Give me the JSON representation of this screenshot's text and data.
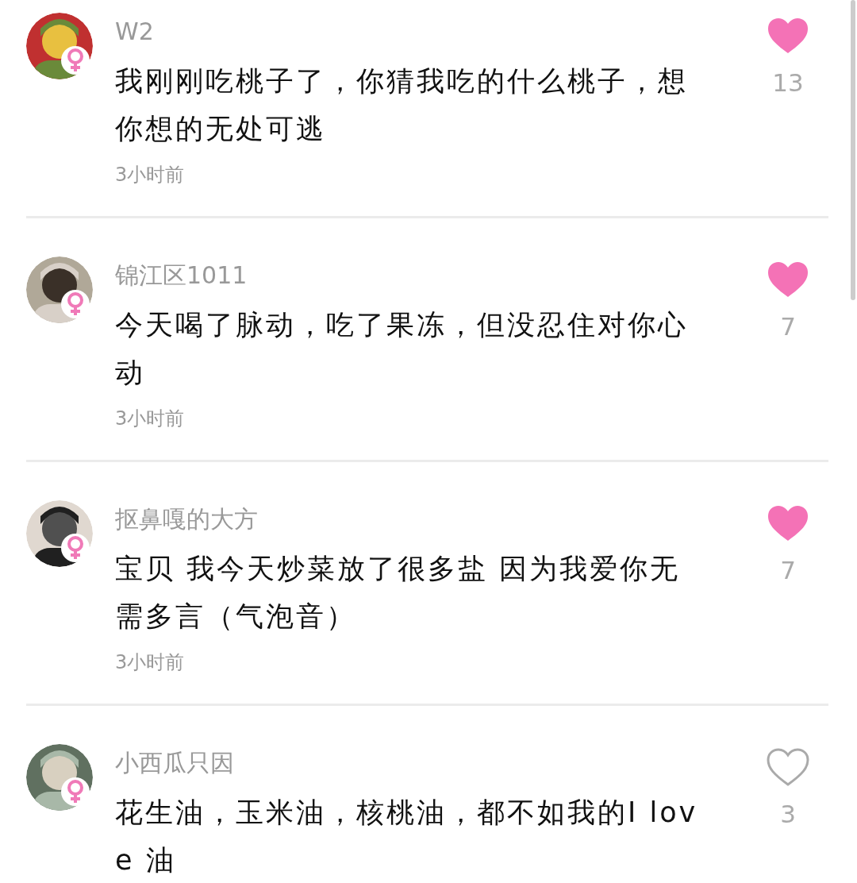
{
  "comments": [
    {
      "username": "W2",
      "text": "我刚刚吃桃子了，你猜我吃的什么桃子，想你想的无处可逃",
      "time": "3小时前",
      "liked": true,
      "likes": "13"
    },
    {
      "username": "锦江区1011",
      "text": "今天喝了脉动，吃了果冻，但没忍住对你心动",
      "time": "3小时前",
      "liked": true,
      "likes": "7"
    },
    {
      "username": "抠鼻嘎的大方",
      "text": "宝贝 我今天炒菜放了很多盐 因为我爱你无需多言（气泡音）",
      "time": "3小时前",
      "liked": true,
      "likes": "7"
    },
    {
      "username": "小西瓜只因",
      "text": "花生油，玉米油，核桃油，都不如我的I love 油",
      "liked": false,
      "likes": "3"
    }
  ]
}
